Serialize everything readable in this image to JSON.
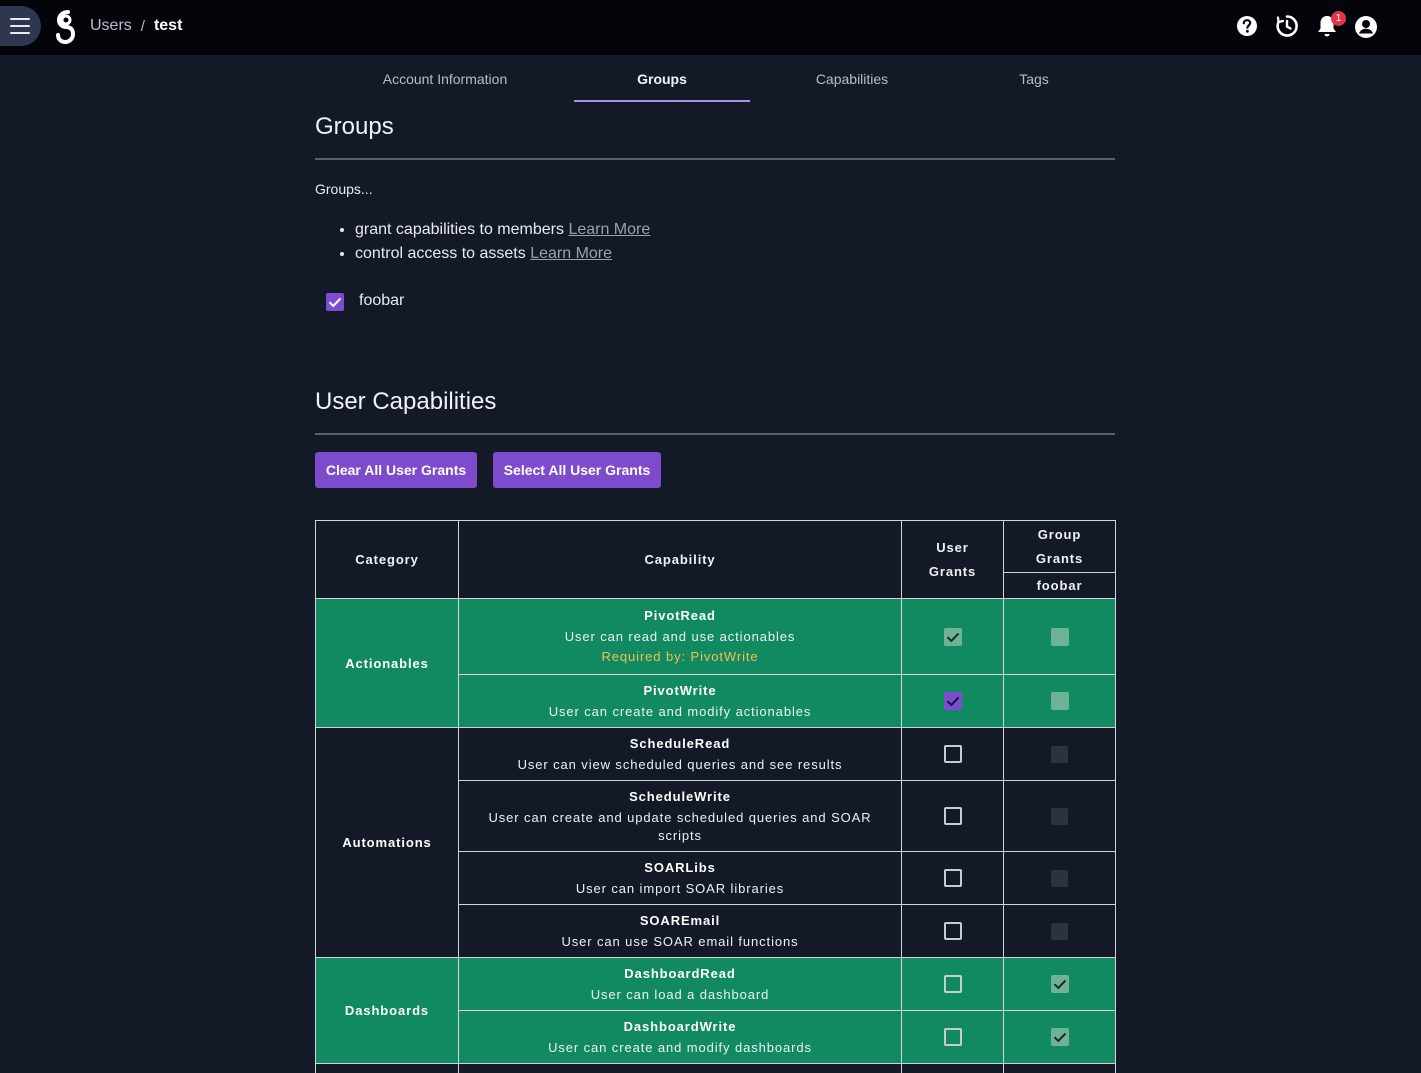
{
  "header": {
    "crumb_parent": "Users",
    "crumb_separator": "/",
    "crumb_current": "test",
    "notification_count": "1",
    "icons": [
      "menu-icon",
      "help-icon",
      "history-icon",
      "bell-icon",
      "account-icon"
    ]
  },
  "tabs": [
    {
      "label": "Account Information",
      "active": false
    },
    {
      "label": "Groups",
      "active": true
    },
    {
      "label": "Capabilities",
      "active": false
    },
    {
      "label": "Tags",
      "active": false
    }
  ],
  "groups": {
    "title": "Groups",
    "intro": "Groups...",
    "bullets": [
      {
        "text": "grant capabilities to members",
        "link": "Learn More"
      },
      {
        "text": "control access to assets",
        "link": "Learn More"
      }
    ],
    "items": [
      {
        "name": "foobar",
        "checked": true
      }
    ]
  },
  "capabilities": {
    "title": "User Capabilities",
    "clear_button": "Clear All User Grants",
    "select_button": "Select All User Grants",
    "table": {
      "headers": {
        "category": "Category",
        "capability": "Capability",
        "user_grants": "User Grants",
        "group_grants": "Group Grants",
        "group_name": "foobar"
      },
      "categories": [
        {
          "name": "Actionables",
          "granted": true,
          "rows": [
            {
              "name": "PivotRead",
              "desc": "User can read and use actionables",
              "required": "Required by: PivotWrite",
              "user": "lite-check",
              "group": "lite-empty"
            },
            {
              "name": "PivotWrite",
              "desc": "User can create and modify actionables",
              "required": "",
              "user": "purple-check",
              "group": "lite-empty"
            }
          ]
        },
        {
          "name": "Automations",
          "granted": false,
          "rows": [
            {
              "name": "ScheduleRead",
              "desc": "User can view scheduled queries and see results",
              "required": "",
              "user": "empty",
              "group": "dim"
            },
            {
              "name": "ScheduleWrite",
              "desc": "User can create and update scheduled queries and SOAR scripts",
              "required": "",
              "user": "empty",
              "group": "dim"
            },
            {
              "name": "SOARLibs",
              "desc": "User can import SOAR libraries",
              "required": "",
              "user": "empty",
              "group": "dim"
            },
            {
              "name": "SOAREmail",
              "desc": "User can use SOAR email functions",
              "required": "",
              "user": "empty",
              "group": "dim"
            }
          ]
        },
        {
          "name": "Dashboards",
          "granted": true,
          "rows": [
            {
              "name": "DashboardRead",
              "desc": "User can load a dashboard",
              "required": "",
              "user": "empty",
              "group": "lite-check"
            },
            {
              "name": "DashboardWrite",
              "desc": "User can create and modify dashboards",
              "required": "",
              "user": "empty",
              "group": "lite-check"
            }
          ]
        }
      ]
    }
  },
  "colors": {
    "background": "#141927",
    "topbar": "#03050a",
    "accent": "#7e4bcc",
    "granted_row": "#118a62",
    "required_text": "#f2c14a"
  }
}
